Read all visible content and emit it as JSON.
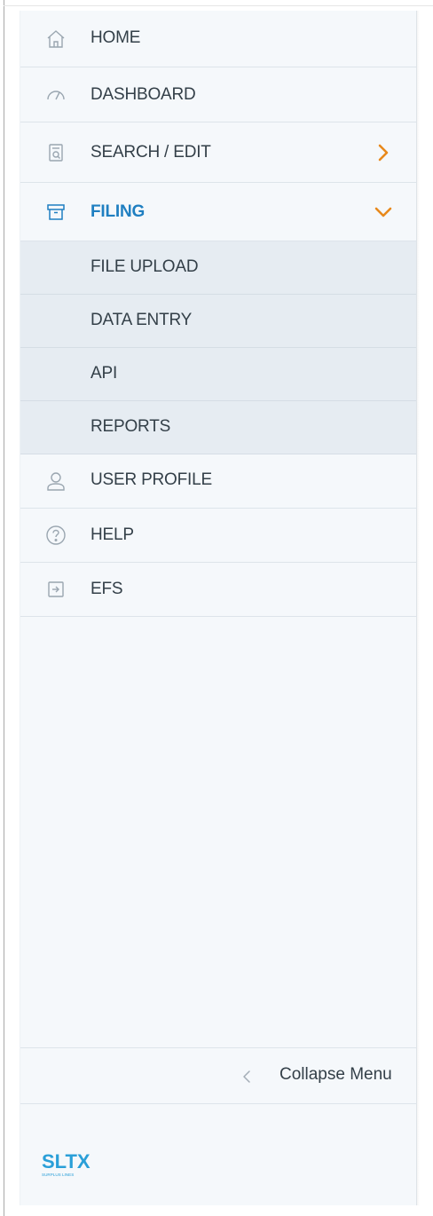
{
  "nav": {
    "items": [
      {
        "label": "HOME",
        "icon": "home-icon"
      },
      {
        "label": "DASHBOARD",
        "icon": "gauge-icon"
      },
      {
        "label": "SEARCH / EDIT",
        "icon": "search-document-icon"
      },
      {
        "label": "FILING",
        "icon": "archive-box-icon"
      },
      {
        "label": "USER PROFILE",
        "icon": "user-icon"
      },
      {
        "label": "HELP",
        "icon": "help-circle-icon"
      },
      {
        "label": "EFS",
        "icon": "sign-in-icon"
      }
    ],
    "filing_submenu": [
      {
        "label": "FILE UPLOAD"
      },
      {
        "label": "DATA ENTRY"
      },
      {
        "label": "API"
      },
      {
        "label": "REPORTS"
      }
    ]
  },
  "footer": {
    "collapse_label": "Collapse Menu"
  },
  "logo": {
    "text": "SLTX",
    "subtext": "SURPLUS LINES"
  },
  "colors": {
    "accent_blue": "#1f7fc1",
    "chevron_orange": "#e8891c",
    "text": "#333f48",
    "sidebar_bg": "#f5f8fb",
    "submenu_bg": "#e6ecf2"
  }
}
